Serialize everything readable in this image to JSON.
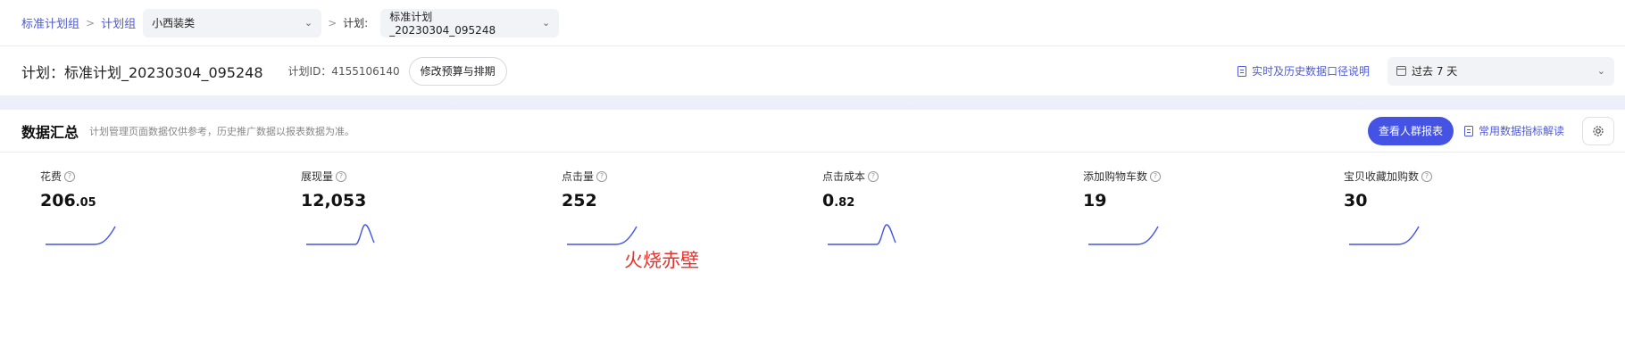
{
  "breadcrumb": {
    "root": "标准计划组",
    "group": "计划组"
  },
  "category_select": {
    "value": "小西装类"
  },
  "plan_select": {
    "label": "计划:",
    "value": "标准计划_20230304_095248"
  },
  "plan_header": {
    "title": "计划：标准计划_20230304_095248",
    "plan_id": "计划ID：4155106140",
    "edit_button": "修改预算与排期",
    "data_doc_link": "实时及历史数据口径说明",
    "date_range": "过去 7 天"
  },
  "summary": {
    "title": "数据汇总",
    "note": "计划管理页面数据仅供参考，历史推广数据以报表数据为准。",
    "crowd_report_button": "查看人群报表",
    "metrics_doc_link": "常用数据指标解读"
  },
  "metrics": [
    {
      "label": "花费",
      "int": "206",
      "dec": ".05",
      "trend": "rise-end"
    },
    {
      "label": "展现量",
      "int": "12,053",
      "dec": "",
      "trend": "peak"
    },
    {
      "label": "点击量",
      "int": "252",
      "dec": "",
      "trend": "rise-end"
    },
    {
      "label": "点击成本",
      "int": "0",
      "dec": ".82",
      "trend": "peak"
    },
    {
      "label": "添加购物车数",
      "int": "19",
      "dec": "",
      "trend": "rise-end"
    },
    {
      "label": "宝贝收藏加购数",
      "int": "30",
      "dec": "",
      "trend": "rise-end"
    }
  ],
  "watermark": "火烧赤壁",
  "colors": {
    "accent": "#4453e3",
    "link": "#4f5bd5",
    "spark": "#4453e3",
    "watermark": "#e8322c"
  },
  "icons": [
    "chevron-down-icon",
    "chevron-right-icon",
    "document-icon",
    "calendar-icon",
    "gear-icon",
    "help-icon"
  ]
}
